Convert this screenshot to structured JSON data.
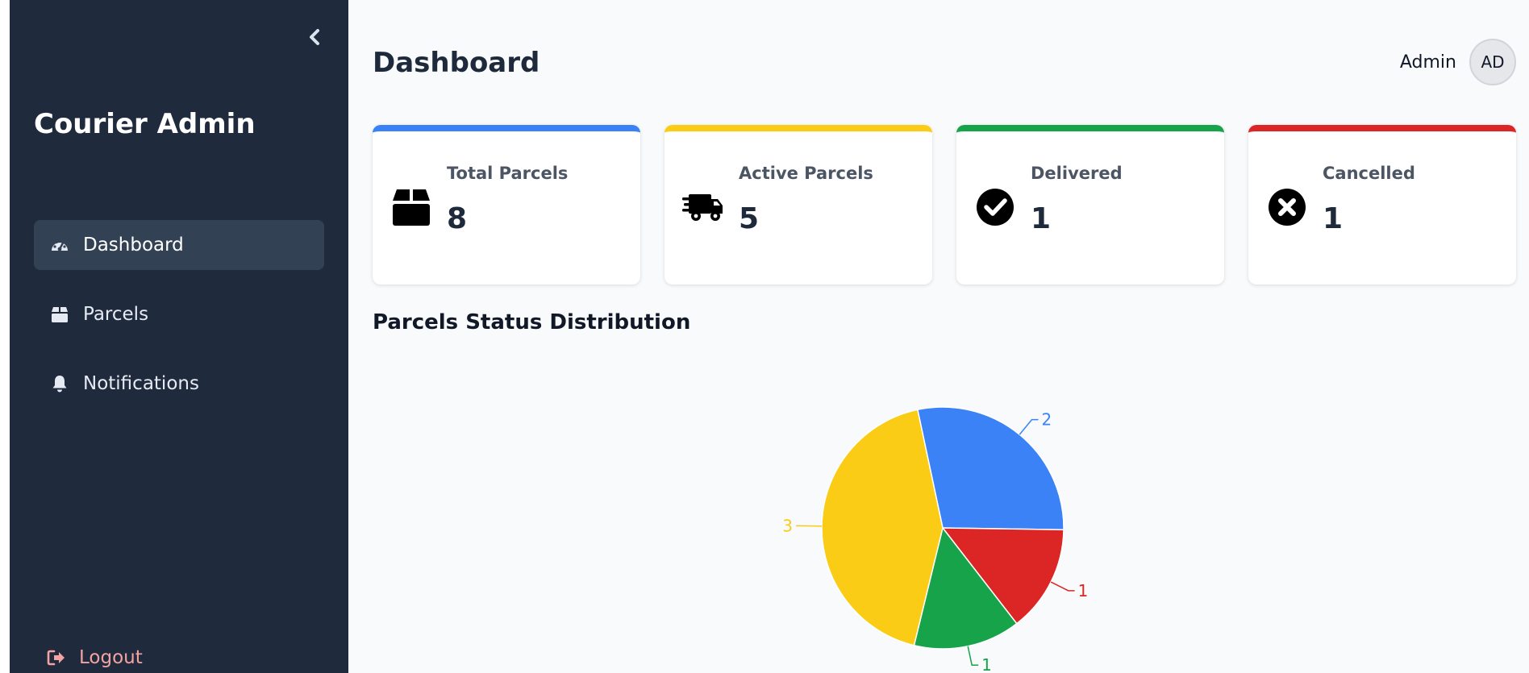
{
  "sidebar": {
    "brand": "Courier Admin",
    "collapse_icon": "chevron-left-icon",
    "items": [
      {
        "label": "Dashboard",
        "icon": "gauge-icon",
        "active": true
      },
      {
        "label": "Parcels",
        "icon": "box-icon",
        "active": false
      },
      {
        "label": "Notifications",
        "icon": "bell-icon",
        "active": false
      }
    ],
    "logout": {
      "label": "Logout",
      "icon": "sign-out-icon"
    }
  },
  "header": {
    "title": "Dashboard",
    "user_name": "Admin",
    "avatar_initials": "AD"
  },
  "stats": [
    {
      "label": "Total Parcels",
      "value": "8",
      "icon": "box-icon",
      "color": "#3b82f6"
    },
    {
      "label": "Active Parcels",
      "value": "5",
      "icon": "truck-fast-icon",
      "color": "#facc15"
    },
    {
      "label": "Delivered",
      "value": "1",
      "icon": "check-circle-icon",
      "color": "#16a34a"
    },
    {
      "label": "Cancelled",
      "value": "1",
      "icon": "x-circle-icon",
      "color": "#dc2626"
    }
  ],
  "chart_section": {
    "title": "Parcels Status Distribution"
  },
  "chart_data": {
    "type": "pie",
    "title": "",
    "slices": [
      {
        "value": 2,
        "color": "#3b82f6"
      },
      {
        "value": 1,
        "color": "#dc2626"
      },
      {
        "value": 1,
        "color": "#16a34a"
      },
      {
        "value": 3,
        "color": "#facc15"
      }
    ]
  }
}
